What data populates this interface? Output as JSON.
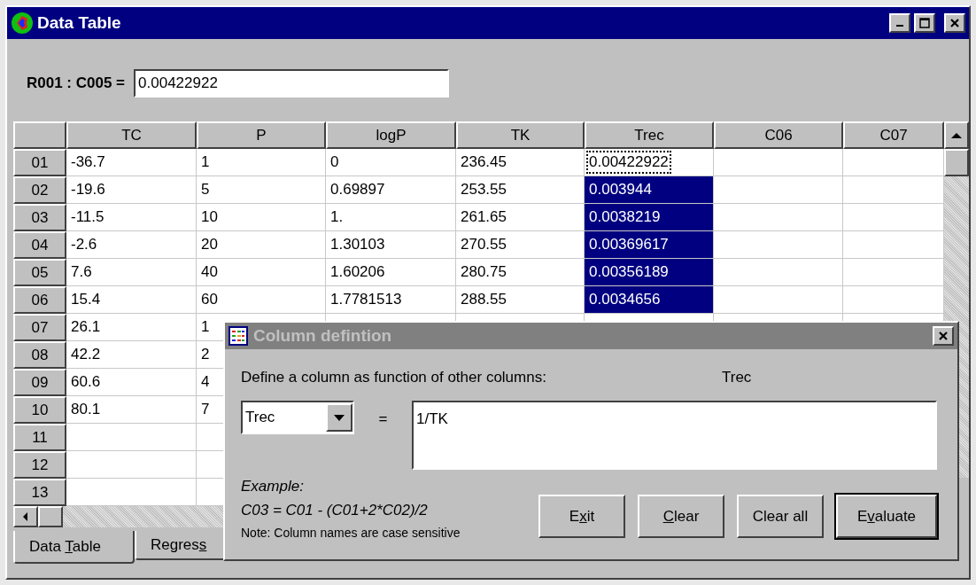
{
  "window": {
    "title": "Data Table"
  },
  "cell_ref": {
    "label": "R001 : C005 =",
    "value": "0.00422922"
  },
  "table": {
    "columns": [
      "TC",
      "P",
      "logP",
      "TK",
      "Trec",
      "C06",
      "C07"
    ],
    "rows": [
      {
        "header": "01",
        "cells": [
          "-36.7",
          "1",
          "0",
          "236.45",
          {
            "text": "0.00422922",
            "selected": false,
            "focused": true
          }
        ]
      },
      {
        "header": "02",
        "cells": [
          "-19.6",
          "5",
          "0.69897",
          "253.55",
          {
            "text": "0.003944",
            "selected": true,
            "focused": false
          }
        ]
      },
      {
        "header": "03",
        "cells": [
          "-11.5",
          "10",
          "1.",
          "261.65",
          {
            "text": "0.0038219",
            "selected": true,
            "focused": false
          }
        ]
      },
      {
        "header": "04",
        "cells": [
          "-2.6",
          "20",
          "1.30103",
          "270.55",
          {
            "text": "0.00369617",
            "selected": true,
            "focused": false
          }
        ]
      },
      {
        "header": "05",
        "cells": [
          "7.6",
          "40",
          "1.60206",
          "280.75",
          {
            "text": "0.00356189",
            "selected": true,
            "focused": false
          }
        ]
      },
      {
        "header": "06",
        "cells": [
          "15.4",
          "60",
          "1.7781513",
          "288.55",
          {
            "text": "0.0034656",
            "selected": true,
            "focused": false
          }
        ]
      },
      {
        "header": "07",
        "cells": [
          "26.1",
          "1"
        ]
      },
      {
        "header": "08",
        "cells": [
          "42.2",
          "2"
        ]
      },
      {
        "header": "09",
        "cells": [
          "60.6",
          "4"
        ]
      },
      {
        "header": "10",
        "cells": [
          "80.1",
          "7"
        ]
      },
      {
        "header": "11"
      },
      {
        "header": "12"
      },
      {
        "header": "13"
      }
    ]
  },
  "tabs": [
    {
      "pre": "Data ",
      "key": "T",
      "post": "able",
      "selected": true
    },
    {
      "pre": "Regres",
      "key": "s",
      "selected": false
    }
  ],
  "dialog": {
    "title": "Column defintion",
    "prompt": "Define a column as function of other columns:",
    "current_column": "Trec",
    "dropdown": {
      "value": "Trec"
    },
    "equals": "=",
    "formula": "1/TK",
    "example_label": "Example:",
    "example": "C03 = C01 - (C01+2*C02)/2",
    "note": "Note: Column names are case sensitive",
    "buttons": [
      {
        "pre": "E",
        "key": "x",
        "post": "it",
        "default": false
      },
      {
        "key": "C",
        "post": "lear",
        "default": false
      },
      {
        "pre": "Clear all",
        "default": false
      },
      {
        "pre": "E",
        "key": "v",
        "post": "aluate",
        "default": true
      }
    ]
  }
}
